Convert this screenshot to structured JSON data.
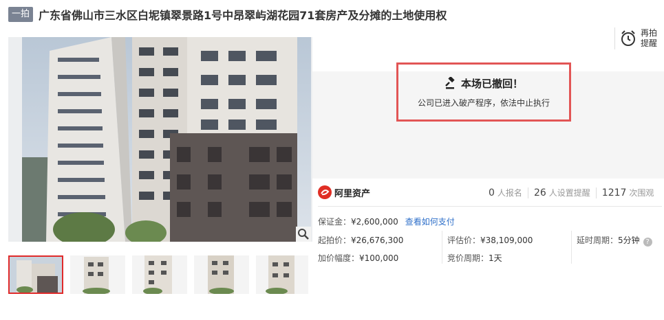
{
  "header": {
    "round_badge": "一拍",
    "title": "广东省佛山市三水区白坭镇翠景路1号中昂翠屿湖花园71套房产及分摊的土地使用权"
  },
  "remind": {
    "label": "再拍提醒"
  },
  "status": {
    "title": "本场已撤回！",
    "subtitle": "公司已进入破产程序，依法中止执行"
  },
  "brand": {
    "name": "阿里资产"
  },
  "stats": [
    {
      "value": "0",
      "label": "人报名"
    },
    {
      "value": "26",
      "label": "人设置提醒"
    },
    {
      "value": "1217",
      "label": "次围观"
    }
  ],
  "details": {
    "deposit_label": "保证金：",
    "deposit_value": "¥2,600,000",
    "pay_link": "查看如何支付",
    "start_price_label": "起拍价：",
    "start_price_value": "¥26,676,300",
    "increment_label": "加价幅度：",
    "increment_value": "¥100,000",
    "appraisal_label": "评估价：",
    "appraisal_value": "¥38,109,000",
    "cycle_label": "竞价周期：",
    "cycle_value": "1天",
    "delay_label": "延时周期：",
    "delay_value": "5分钟"
  },
  "icons": {
    "remind": "alarm-clock-icon",
    "status": "auction-gavel-icon",
    "zoom": "magnifier-icon",
    "brand": "alibaba-logo-icon",
    "help": "question-icon"
  }
}
